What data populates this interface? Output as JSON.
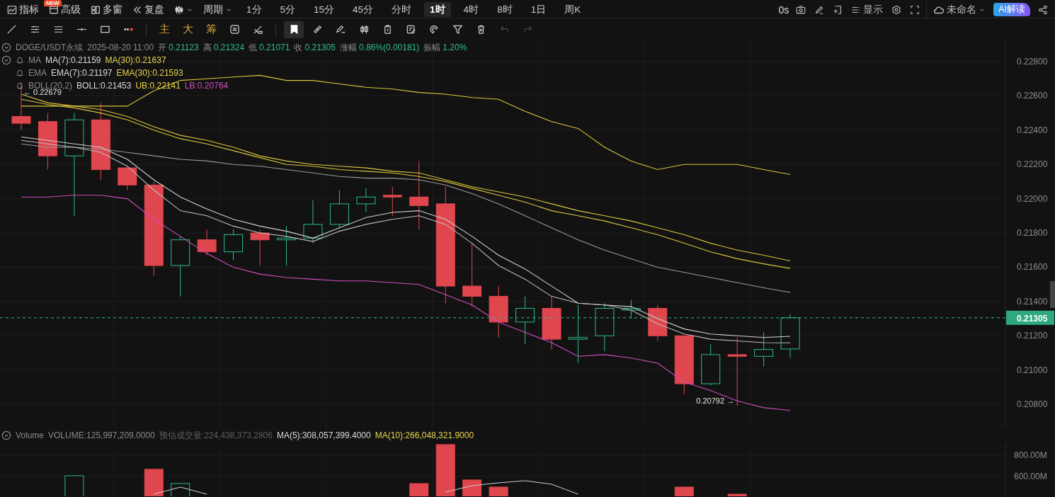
{
  "top_bar": {
    "tools": [
      {
        "kind": "trend-chart",
        "label": "指标",
        "badge": "NEW"
      },
      {
        "kind": "window",
        "label": "高级"
      },
      {
        "kind": "grid",
        "label": "多窗"
      },
      {
        "kind": "rewind",
        "label": "复盘"
      },
      {
        "kind": "candlestick",
        "dropdown": true
      },
      {
        "kind": "text",
        "label": "周期",
        "dropdown": true
      }
    ],
    "intervals": [
      {
        "label": "1分",
        "selected": false
      },
      {
        "label": "5分",
        "selected": false
      },
      {
        "label": "15分",
        "selected": false
      },
      {
        "label": "45分",
        "selected": false
      },
      {
        "label": "分时",
        "selected": false
      },
      {
        "label": "1时",
        "selected": true
      },
      {
        "label": "4时",
        "selected": false
      },
      {
        "label": "8时",
        "selected": false
      },
      {
        "label": "1日",
        "selected": false
      },
      {
        "label": "周K",
        "selected": false
      }
    ],
    "timer": "0s",
    "actions": [
      {
        "kind": "camera"
      },
      {
        "kind": "pencil"
      },
      {
        "kind": "frame-plus"
      },
      {
        "kind": "list",
        "label": "显示"
      },
      {
        "kind": "settings"
      },
      {
        "kind": "fullscreen"
      }
    ],
    "layout": {
      "label": "未命名"
    },
    "ai_button": "AI解读"
  },
  "drawing_toolbar": {
    "groups": [
      [
        {
          "kind": "diagonal-line",
          "selected": false
        },
        {
          "kind": "horizontal-lines",
          "selected": false
        },
        {
          "kind": "parallel-lines",
          "selected": false
        },
        {
          "kind": "horizontal-segment",
          "selected": false
        },
        {
          "kind": "rectangle",
          "selected": false
        },
        {
          "kind": "dots",
          "selected": false
        }
      ],
      [
        {
          "kind": "text",
          "text": "主",
          "selected": false
        },
        {
          "kind": "text",
          "text": "大",
          "selected": false
        },
        {
          "kind": "text",
          "text": "筹",
          "selected": false
        },
        {
          "kind": "cycle",
          "selected": false
        },
        {
          "kind": "measure",
          "selected": false
        }
      ],
      [
        {
          "kind": "bookmark",
          "selected": true
        },
        {
          "kind": "ruler",
          "selected": false
        },
        {
          "kind": "pen",
          "selected": false
        },
        {
          "kind": "candle-pair",
          "selected": false
        },
        {
          "kind": "clipboard",
          "selected": false
        },
        {
          "kind": "note",
          "selected": false
        },
        {
          "kind": "magnet",
          "selected": false
        },
        {
          "kind": "filter",
          "selected": false
        },
        {
          "kind": "trash",
          "selected": false
        }
      ]
    ],
    "history": [
      {
        "kind": "undo",
        "disabled": true
      },
      {
        "kind": "redo",
        "disabled": true
      }
    ]
  },
  "price_chart": {
    "legend": {
      "symbol": "DOGE/USDT永续",
      "time": "2025-08-20 11:00",
      "stats": [
        {
          "label": "开",
          "value": "0.21123"
        },
        {
          "label": "高",
          "value": "0.21324"
        },
        {
          "label": "低",
          "value": "0.21071"
        },
        {
          "label": "收",
          "value": "0.21305"
        },
        {
          "label": "涨幅",
          "value": "0.86%(0.00181)"
        },
        {
          "label": "振幅",
          "value": "1.20%"
        }
      ],
      "indicators": [
        {
          "name": "MA",
          "values": [
            {
              "text": "MA(7):0.21159",
              "color": "#d9d9d9"
            },
            {
              "text": "MA(30):0.21637",
              "color": "#e8d44d"
            }
          ]
        },
        {
          "name": "EMA",
          "values": [
            {
              "text": "EMA(7):0.21197",
              "color": "#d9d9d9"
            },
            {
              "text": "EMA(30):0.21593",
              "color": "#e8d44d"
            }
          ]
        },
        {
          "name": "BOLL(20,2)",
          "values": [
            {
              "text": "BOLL:0.21453",
              "color": "#d9d9d9"
            },
            {
              "text": "UB:0.22141",
              "color": "#e8d44d"
            },
            {
              "text": "LB:0.20764",
              "color": "#d04fbe"
            }
          ]
        }
      ]
    },
    "high_label": "← 0.22679",
    "low_label": "0.20792 →",
    "chart_data": {
      "type": "line",
      "grid": true,
      "ylim": [
        0.20664,
        0.22924
      ],
      "ref_lines": [
        {
          "axis": "y",
          "value": 0.21305,
          "label": "0.21305"
        }
      ],
      "yticks": [
        {
          "value": 0.228,
          "label": "0.22800"
        },
        {
          "value": 0.226,
          "label": "0.22600"
        },
        {
          "value": 0.224,
          "label": "0.22400"
        },
        {
          "value": 0.222,
          "label": "0.22200"
        },
        {
          "value": 0.22,
          "label": "0.22000"
        },
        {
          "value": 0.218,
          "label": "0.21800"
        },
        {
          "value": 0.216,
          "label": "0.21600"
        },
        {
          "value": 0.214,
          "label": "0.21400"
        },
        {
          "value": 0.212,
          "label": "0.21200"
        },
        {
          "value": 0.21,
          "label": "0.21000"
        },
        {
          "value": 0.208,
          "label": "0.20800"
        }
      ],
      "series": [
        {
          "color": "#d8c53a",
          "values": [
            0.2254,
            0.2254,
            0.2254,
            0.2254,
            0.2254,
            0.2263,
            0.2269,
            0.227,
            0.2271,
            0.2272,
            0.2269,
            0.2269,
            0.2267,
            0.2265,
            0.2264,
            0.2262,
            0.2261,
            0.2259,
            0.2258,
            0.2251,
            0.2245,
            0.2241,
            0.223,
            0.2222,
            0.2217,
            0.222,
            0.222,
            0.222,
            0.2217,
            0.22141
          ]
        },
        {
          "color": "#d8c53a",
          "values": [
            0.2261,
            0.2256,
            0.2254,
            0.2252,
            0.2248,
            0.2242,
            0.2237,
            0.2234,
            0.223,
            0.2225,
            0.2222,
            0.222,
            0.2219,
            0.2218,
            0.2216,
            0.2215,
            0.2211,
            0.2207,
            0.2204,
            0.2201,
            0.2197,
            0.2193,
            0.219,
            0.2187,
            0.2183,
            0.2179,
            0.2174,
            0.217,
            0.2167,
            0.21637
          ]
        },
        {
          "color": "#d8c53a",
          "values": [
            0.2258,
            0.2255,
            0.2253,
            0.225,
            0.2246,
            0.224,
            0.2235,
            0.2232,
            0.2228,
            0.2224,
            0.222,
            0.2219,
            0.2217,
            0.2216,
            0.2215,
            0.2213,
            0.221,
            0.2206,
            0.2202,
            0.2198,
            0.2193,
            0.219,
            0.2187,
            0.2183,
            0.2179,
            0.2174,
            0.2169,
            0.2165,
            0.2162,
            0.21593
          ]
        },
        {
          "color": "#9a9a9a",
          "values": [
            0.2232,
            0.223,
            0.223,
            0.2229,
            0.2227,
            0.2225,
            0.2223,
            0.2222,
            0.222,
            0.2219,
            0.2217,
            0.2215,
            0.2213,
            0.2212,
            0.2212,
            0.2211,
            0.2208,
            0.2203,
            0.2197,
            0.219,
            0.2183,
            0.2176,
            0.217,
            0.2165,
            0.216,
            0.2157,
            0.2154,
            0.2151,
            0.2148,
            0.21453
          ]
        },
        {
          "color": "#d0d0d0",
          "values": [
            0.2236,
            0.2234,
            0.2232,
            0.223,
            0.2223,
            0.2211,
            0.2201,
            0.2194,
            0.2188,
            0.2184,
            0.2181,
            0.2177,
            0.2183,
            0.2189,
            0.2192,
            0.2193,
            0.2188,
            0.2178,
            0.2167,
            0.2159,
            0.2149,
            0.2139,
            0.2138,
            0.2137,
            0.213,
            0.2124,
            0.2121,
            0.212,
            0.2119,
            0.21197
          ]
        },
        {
          "color": "#bdbdbd",
          "values": [
            0.2234,
            0.2232,
            0.223,
            0.2227,
            0.2219,
            0.2205,
            0.2193,
            0.219,
            0.2184,
            0.218,
            0.2178,
            0.2175,
            0.2181,
            0.2185,
            0.2188,
            0.219,
            0.2185,
            0.2174,
            0.2161,
            0.2153,
            0.2143,
            0.2139,
            0.2138,
            0.2135,
            0.2127,
            0.2121,
            0.2118,
            0.2117,
            0.2116,
            0.21159
          ]
        },
        {
          "color": "#d04fbe",
          "values": [
            0.2201,
            0.2201,
            0.2202,
            0.2202,
            0.22,
            0.2188,
            0.2178,
            0.2168,
            0.216,
            0.2156,
            0.2154,
            0.2153,
            0.2152,
            0.2152,
            0.2151,
            0.215,
            0.2144,
            0.2138,
            0.2128,
            0.2122,
            0.2116,
            0.2108,
            0.2109,
            0.2107,
            0.2104,
            0.2093,
            0.2088,
            0.2082,
            0.2078,
            0.20764
          ]
        }
      ]
    }
  },
  "volume_chart": {
    "legend": {
      "name": "Volume",
      "values": [
        {
          "text": "VOLUME:125,997,209.0000",
          "color": "#8a8a8a"
        },
        {
          "text": "预估成交量:224,438,373.2806",
          "color": "#5e5e5e"
        },
        {
          "text": "MA(5):308,057,399.4000",
          "color": "#d9d9d9"
        },
        {
          "text": "MA(10):266,048,321.9000",
          "color": "#e8d44d"
        }
      ]
    },
    "axis_labels": [
      "800.00M",
      "600.00M"
    ]
  }
}
